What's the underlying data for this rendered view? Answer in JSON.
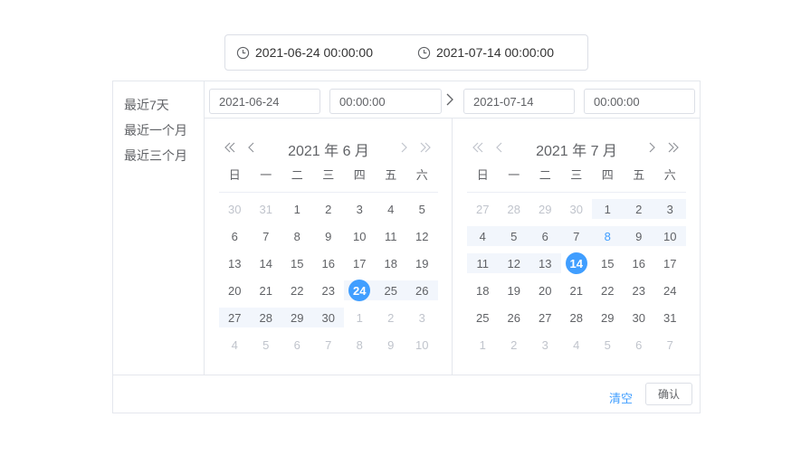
{
  "range_input": {
    "start": "2021-06-24 00:00:00",
    "end": "2021-07-14 00:00:00"
  },
  "shortcuts": [
    "最近7天",
    "最近一个月",
    "最近三个月"
  ],
  "header": {
    "start_date": "2021-06-24",
    "start_time": "00:00:00",
    "end_date": "2021-07-14",
    "end_time": "00:00:00"
  },
  "weekdays": [
    "日",
    "一",
    "二",
    "三",
    "四",
    "五",
    "六"
  ],
  "left_calendar": {
    "title": "2021 年 6 月",
    "weeks": [
      [
        {
          "d": "30",
          "m": 1
        },
        {
          "d": "31",
          "m": 1
        },
        {
          "d": "1"
        },
        {
          "d": "2"
        },
        {
          "d": "3"
        },
        {
          "d": "4"
        },
        {
          "d": "5"
        }
      ],
      [
        {
          "d": "6"
        },
        {
          "d": "7"
        },
        {
          "d": "8"
        },
        {
          "d": "9"
        },
        {
          "d": "10"
        },
        {
          "d": "11"
        },
        {
          "d": "12"
        }
      ],
      [
        {
          "d": "13"
        },
        {
          "d": "14"
        },
        {
          "d": "15"
        },
        {
          "d": "16"
        },
        {
          "d": "17"
        },
        {
          "d": "18"
        },
        {
          "d": "19"
        }
      ],
      [
        {
          "d": "20"
        },
        {
          "d": "21"
        },
        {
          "d": "22"
        },
        {
          "d": "23"
        },
        {
          "d": "24",
          "s": 1,
          "r": 1
        },
        {
          "d": "25",
          "r": 1
        },
        {
          "d": "26",
          "r": 1
        }
      ],
      [
        {
          "d": "27",
          "r": 1
        },
        {
          "d": "28",
          "r": 1
        },
        {
          "d": "29",
          "r": 1
        },
        {
          "d": "30",
          "r": 1
        },
        {
          "d": "1",
          "m": 1
        },
        {
          "d": "2",
          "m": 1
        },
        {
          "d": "3",
          "m": 1
        }
      ],
      [
        {
          "d": "4",
          "m": 1
        },
        {
          "d": "5",
          "m": 1
        },
        {
          "d": "6",
          "m": 1
        },
        {
          "d": "7",
          "m": 1
        },
        {
          "d": "8",
          "m": 1
        },
        {
          "d": "9",
          "m": 1
        },
        {
          "d": "10",
          "m": 1
        }
      ]
    ]
  },
  "right_calendar": {
    "title": "2021 年 7 月",
    "weeks": [
      [
        {
          "d": "27",
          "m": 1
        },
        {
          "d": "28",
          "m": 1
        },
        {
          "d": "29",
          "m": 1
        },
        {
          "d": "30",
          "m": 1
        },
        {
          "d": "1",
          "r": 1
        },
        {
          "d": "2",
          "r": 1
        },
        {
          "d": "3",
          "r": 1
        }
      ],
      [
        {
          "d": "4",
          "r": 1
        },
        {
          "d": "5",
          "r": 1
        },
        {
          "d": "6",
          "r": 1
        },
        {
          "d": "7",
          "r": 1
        },
        {
          "d": "8",
          "r": 1,
          "t": 1
        },
        {
          "d": "9",
          "r": 1
        },
        {
          "d": "10",
          "r": 1
        }
      ],
      [
        {
          "d": "11",
          "r": 1
        },
        {
          "d": "12",
          "r": 1
        },
        {
          "d": "13",
          "r": 1
        },
        {
          "d": "14",
          "s": 1
        },
        {
          "d": "15"
        },
        {
          "d": "16"
        },
        {
          "d": "17"
        }
      ],
      [
        {
          "d": "18"
        },
        {
          "d": "19"
        },
        {
          "d": "20"
        },
        {
          "d": "21"
        },
        {
          "d": "22"
        },
        {
          "d": "23"
        },
        {
          "d": "24"
        }
      ],
      [
        {
          "d": "25"
        },
        {
          "d": "26"
        },
        {
          "d": "27"
        },
        {
          "d": "28"
        },
        {
          "d": "29"
        },
        {
          "d": "30"
        },
        {
          "d": "31"
        }
      ],
      [
        {
          "d": "1",
          "m": 1
        },
        {
          "d": "2",
          "m": 1
        },
        {
          "d": "3",
          "m": 1
        },
        {
          "d": "4",
          "m": 1
        },
        {
          "d": "5",
          "m": 1
        },
        {
          "d": "6",
          "m": 1
        },
        {
          "d": "7",
          "m": 1
        }
      ]
    ]
  },
  "footer": {
    "clear_label": "清空",
    "confirm_label": "确认"
  },
  "colors": {
    "accent": "#409eff",
    "range_band": "#f2f6fc",
    "muted_text": "#c0c4cc"
  },
  "icons": {
    "clock": "clock-icon",
    "double_left": "double-chevron-left-icon",
    "left": "chevron-left-icon",
    "right": "chevron-right-icon",
    "double_right": "double-chevron-right-icon",
    "range_arrow": "chevron-right-icon"
  }
}
